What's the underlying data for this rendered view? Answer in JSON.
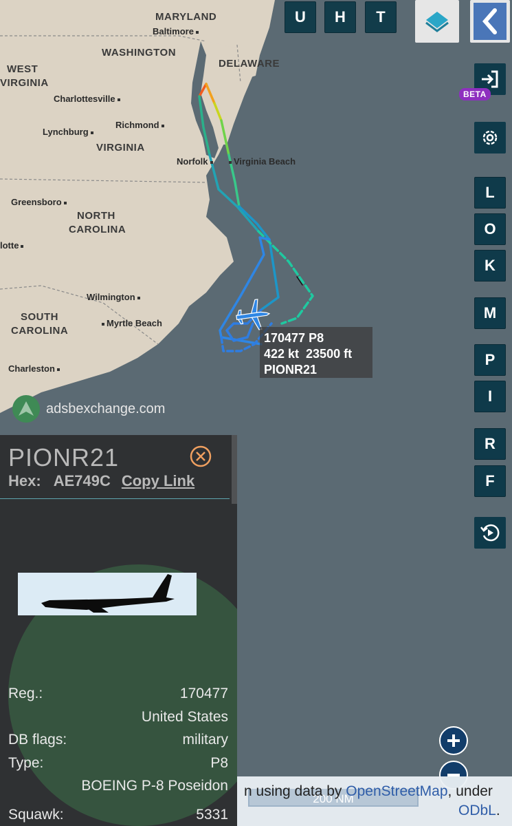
{
  "map": {
    "labels": {
      "maryland": "MARYLAND",
      "baltimore": "Baltimore",
      "washington": "WASHINGTON",
      "delaware": "DELAWARE",
      "west_virginia_1": "WEST",
      "west_virginia_2": "VIRGINIA",
      "charlottesville": "Charlottesville",
      "lynchburg": "Lynchburg",
      "richmond": "Richmond",
      "virginia": "VIRGINIA",
      "norfolk": "Norfolk",
      "virginia_beach": "Virginia Beach",
      "greensboro": "Greensboro",
      "north_carolina_1": "NORTH",
      "north_carolina_2": "CAROLINA",
      "charlotte": "lotte",
      "wilmington": "Wilmington",
      "myrtle_beach": "Myrtle Beach",
      "south_carolina_1": "SOUTH",
      "south_carolina_2": "CAROLINA",
      "charleston": "Charleston"
    },
    "colors": {
      "land": "#dcd3c4",
      "water": "#5b6a73",
      "track_low": "#2f7de1",
      "track_mid": "#1fc9a0",
      "track_high": "#f25c1e"
    }
  },
  "top_buttons": {
    "u": "U",
    "h": "H",
    "t": "T"
  },
  "side_buttons": {
    "l": "L",
    "o": "O",
    "k": "K",
    "m": "M",
    "p": "P",
    "i": "I",
    "r": "R",
    "f": "F"
  },
  "beta_badge": "BETA",
  "aircraft_label": {
    "line1": "170477 P8",
    "line2": "422 kt  23500 ft",
    "line3": "PIONR21"
  },
  "watermark": "adsbexchange.com",
  "panel": {
    "callsign": "PIONR21",
    "hex_label": "Hex:",
    "hex_value": "AE749C",
    "copy_link": "Copy Link",
    "reg_label": "Reg.:",
    "reg_value": "170477",
    "country": "United States",
    "db_flags_label": "DB flags:",
    "db_flags_value": "military",
    "type_label": "Type:",
    "type_value": "P8",
    "type_desc": "BOEING P-8 Poseidon",
    "squawk_label": "Squawk:",
    "squawk_value": "5331"
  },
  "attribution": {
    "scale": "200 NM",
    "prefix": "n using data by ",
    "osm": "OpenStreetMap",
    "mid": ", under",
    "odbl": "ODbL",
    "suffix": "."
  }
}
